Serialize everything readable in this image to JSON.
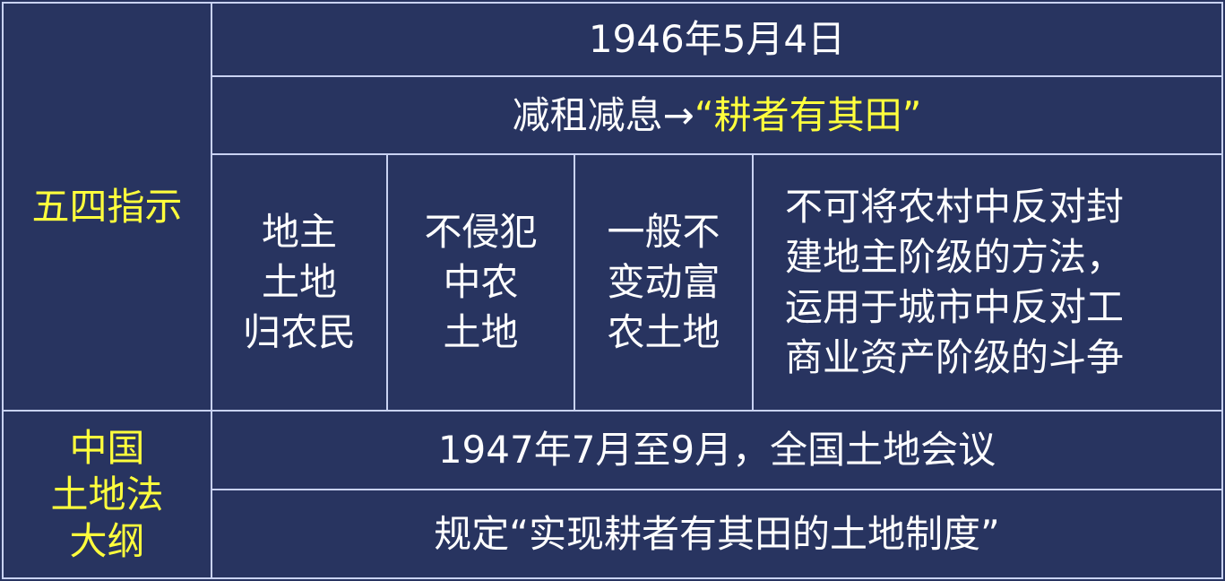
{
  "colors": {
    "background": "#283460",
    "border": "#c9d2f2",
    "highlight": "#ffff3c",
    "text": "#ffffff"
  },
  "wusi": {
    "label": "五四指示",
    "date": "1946年5月4日",
    "change_prefix": "减租减息→",
    "change_highlight": "“耕者有其田”",
    "points": [
      "地主\n土地\n归农民",
      "不侵犯\n中农\n土地",
      "一般不\n变动富\n农土地",
      "不可将农村中反对封\n建地主阶级的方法，\n运用于城市中反对工\n商业资产阶级的斗争"
    ]
  },
  "land_law": {
    "label": "中国\n土地法\n大纲",
    "meeting": "1947年7月至9月，全国土地会议",
    "provision": "规定“实现耕者有其田的土地制度”"
  }
}
